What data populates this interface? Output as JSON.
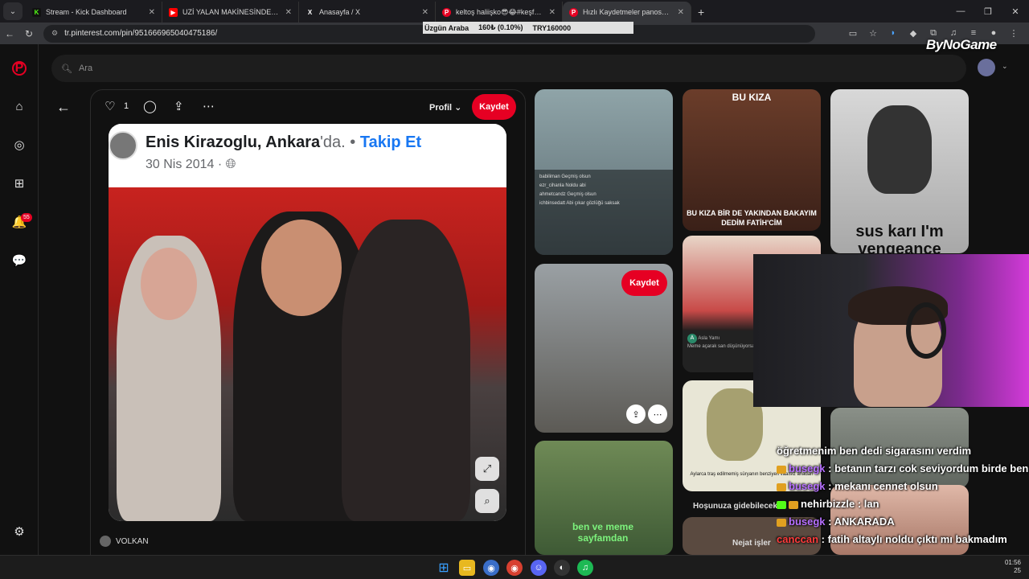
{
  "browser": {
    "tabs": [
      {
        "title": "Stream - Kick Dashboard",
        "icon": "kick-icon",
        "color": "#53fc18"
      },
      {
        "title": "UZİ YALAN MAKİNESİNDE! | #P",
        "icon": "youtube-icon",
        "color": "#ff0000"
      },
      {
        "title": "Anasayfa / X",
        "icon": "x-icon",
        "color": "#ffffff"
      },
      {
        "title": "keltoş haliişko😎😂#keşfet #",
        "icon": "pinterest-icon",
        "color": "#e60023"
      },
      {
        "title": "Hızlı Kaydetmeler panosundaki",
        "icon": "pinterest-icon",
        "color": "#e60023",
        "active": true
      }
    ],
    "url": "tr.pinterest.com/pin/951666965040475186/"
  },
  "ticker": {
    "name": "Üzgün Araba",
    "price": "160₺ (0.10%)",
    "cap": "TRY160000"
  },
  "pinterest": {
    "search_placeholder": "Ara",
    "notification_count": "55",
    "pin": {
      "likes": "1",
      "profile_label": "Profil",
      "save_label": "Kaydet",
      "post_name": "Enis Kirazoglu",
      "post_location": "Ankara",
      "post_location_suffix": "'da.",
      "post_follow": "Takip Et",
      "post_date": "30 Nis 2014",
      "board_owner": "VOLKAN"
    },
    "grid": {
      "bu_kiza_top": "BU KIZA",
      "bu_kiza_bottom": "BU KIZA BİR DE YAKINDAN BAKAYIM DEDİM FATİH'CİM",
      "sus_kari": "sus karı I'm",
      "sus_kari_2": "vengeance",
      "save_label": "Kaydet",
      "ben_ve_meme": "ben ve meme sayfamdan",
      "hosunuza": "Hoşunuza gidebilecek",
      "nejat": "Nejat işler",
      "comment_user": "Asla Yamı",
      "comment_text": "Meme açarak san düşünüyorsan bu",
      "aylarca": "Aylarca traş edilmemiş süryanın benziyen vaafsız anadan",
      "hospital_comments": [
        {
          "user": "babiliman",
          "text": "Geçmiş olsun"
        },
        {
          "user": "ezr_cihanla",
          "text": "Noldu abi"
        },
        {
          "user": "ahmetcandz",
          "text": "Geçmiş olsun"
        },
        {
          "user": "ichbinsedatt",
          "text": "Abi çıkar gözlüğü saksak"
        }
      ]
    }
  },
  "overlay": {
    "brand": "ByNoGame",
    "chat": [
      {
        "user": "",
        "text": "öğretmenim ben dedi sigarasını verdim"
      },
      {
        "user": "busegk",
        "text": ": betanın tarzı cok seviyordum birde ben"
      },
      {
        "user": "busegk",
        "text": ": mekanı cennet olsun"
      },
      {
        "user": "nehirbizzle",
        "text": ": lan"
      },
      {
        "user": "busegk",
        "text": ": ANKARADA"
      },
      {
        "user": "canccan",
        "text": ": fatih altaylı noldu çıktı mı bakmadım"
      }
    ]
  },
  "taskbar": {
    "time": "01:56",
    "date": "25"
  }
}
